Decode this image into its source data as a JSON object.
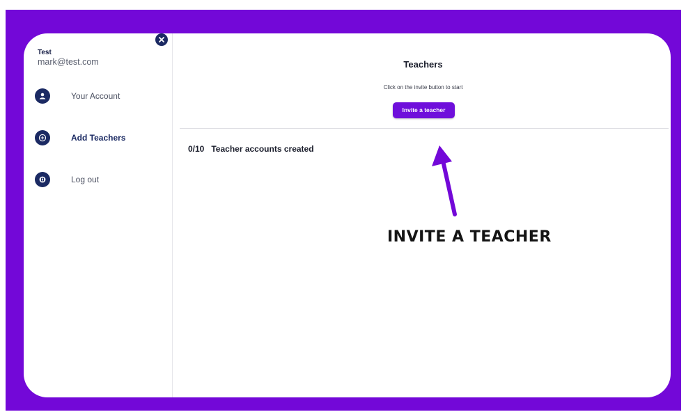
{
  "colors": {
    "frame": "#7308d8",
    "accent": "#6f0fdb",
    "nav_icon": "#1b2a63"
  },
  "user": {
    "name": "Test",
    "email": "mark@test.com"
  },
  "sidebar": {
    "items": [
      {
        "label": "Your Account",
        "icon": "user-icon"
      },
      {
        "label": "Add Teachers",
        "icon": "plus-circle-icon",
        "active": true
      },
      {
        "label": "Log out",
        "icon": "logout-icon"
      }
    ]
  },
  "main": {
    "title": "Teachers",
    "subtitle": "Click on the invite button to start",
    "invite_label": "Invite a teacher",
    "count": "0/10",
    "count_label": "Teacher accounts created"
  },
  "annotation": {
    "text": "INVITE A TEACHER"
  }
}
